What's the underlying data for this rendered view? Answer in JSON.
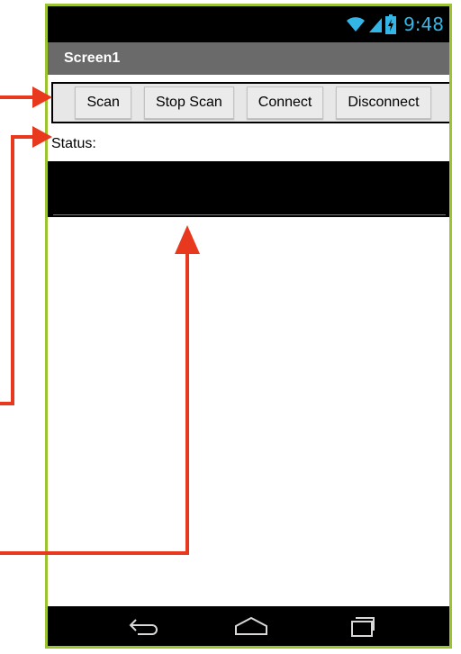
{
  "status_bar": {
    "time": "9:48",
    "icons": [
      "wifi-icon",
      "signal-icon",
      "battery-icon"
    ]
  },
  "title_bar": {
    "title": "Screen1"
  },
  "buttons": {
    "scan": "Scan",
    "stop_scan": "Stop Scan",
    "connect": "Connect",
    "disconnect": "Disconnect"
  },
  "status": {
    "label": "Status:",
    "value": ""
  },
  "nav_bar": {
    "icons": [
      "back-icon",
      "home-icon",
      "recent-apps-icon"
    ]
  },
  "colors": {
    "frame_border": "#9cc431",
    "status_bar_icons": "#33b5e5",
    "title_bar": "#6a6a6a",
    "annotation_arrows": "#e8391f"
  }
}
